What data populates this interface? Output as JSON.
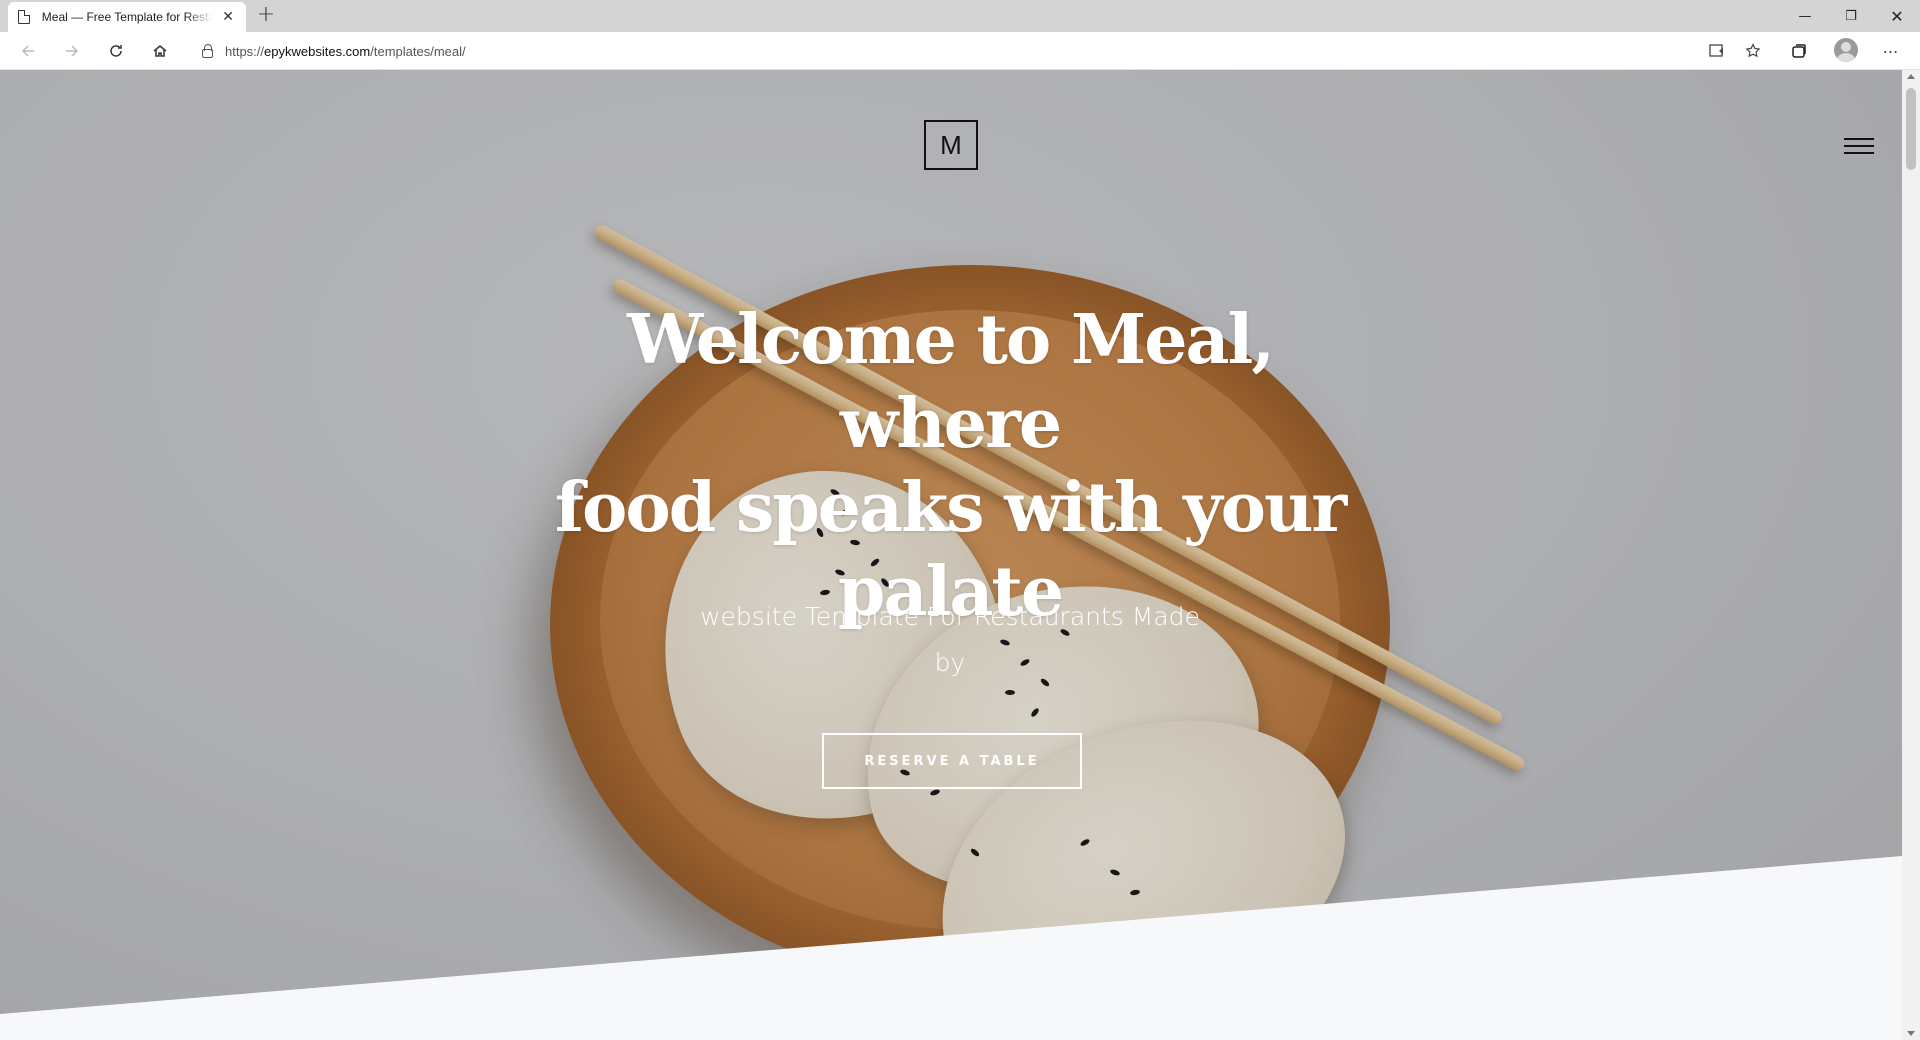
{
  "browser": {
    "tab_title": "Meal — Free Template for Restaurants",
    "tab_close": "✕",
    "new_tab": "+",
    "url_prefix": "https://",
    "url_host": "epykwebsites.com",
    "url_path": "/templates/meal/",
    "window_controls": {
      "minimize": "—",
      "maximize": "❐",
      "close": "✕"
    },
    "toolbar_icons": [
      "back-icon",
      "forward-icon",
      "reload-icon",
      "home-icon",
      "lock-icon",
      "reader-icon",
      "favorites-icon",
      "collections-icon",
      "profile-icon",
      "more-icon"
    ]
  },
  "page": {
    "logo_letter": "M",
    "headline_lines": [
      "Welcome to Meal, where",
      "food speaks with your",
      "palate"
    ],
    "subline_lines": [
      "website Template For Restaurants Made",
      "by"
    ],
    "cta_label": "RESERVE A TABLE"
  },
  "colors": {
    "hero_background": "#c4c5c9",
    "section_background": "#f7f8fa",
    "text_on_hero": "#ffffff",
    "logo_border": "#111111"
  }
}
